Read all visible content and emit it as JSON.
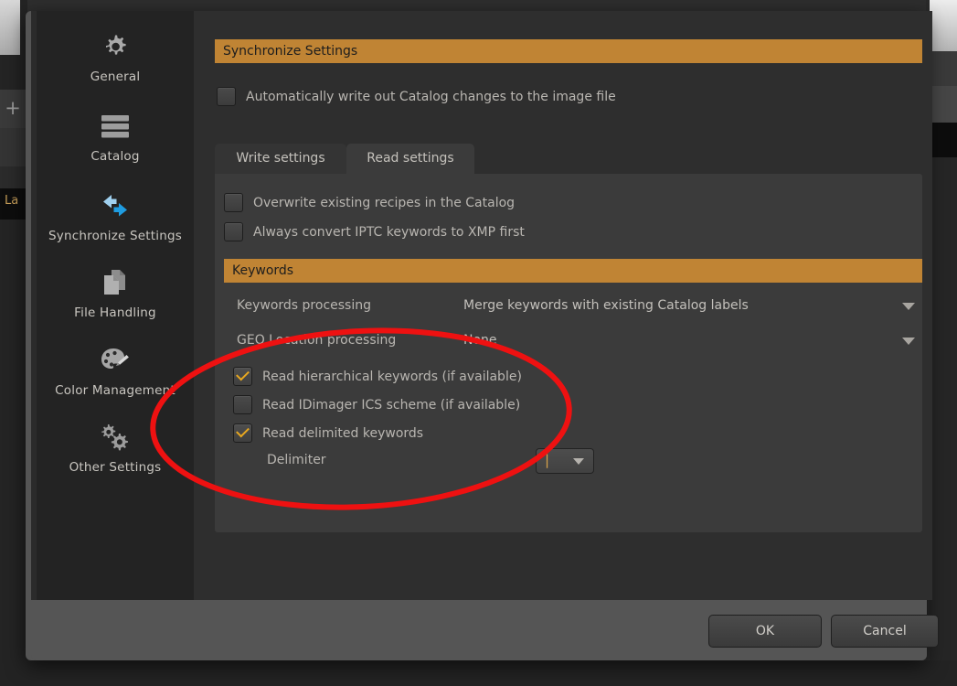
{
  "dialog": {
    "sidebar": {
      "items": [
        {
          "label": "General",
          "icon": "gear-icon"
        },
        {
          "label": "Catalog",
          "icon": "stacked-bars-icon"
        },
        {
          "label": "Synchronize Settings",
          "icon": "sync-arrows-icon"
        },
        {
          "label": "File Handling",
          "icon": "documents-icon"
        },
        {
          "label": "Color Management",
          "icon": "palette-icon"
        },
        {
          "label": "Other Settings",
          "icon": "double-gear-icon"
        }
      ]
    },
    "main": {
      "section_header": "Synchronize Settings",
      "auto_write_checkbox": {
        "label": "Automatically write out Catalog changes to the image file",
        "checked": false
      },
      "tabs": [
        {
          "label": "Write settings",
          "active": false
        },
        {
          "label": "Read settings",
          "active": true
        }
      ],
      "read_settings": {
        "checkboxes": [
          {
            "label": "Overwrite existing recipes in the Catalog",
            "checked": false
          },
          {
            "label": "Always convert IPTC keywords to XMP first",
            "checked": false
          }
        ],
        "keywords_header": "Keywords",
        "dropdowns": [
          {
            "label": "Keywords processing",
            "value": "Merge keywords with existing Catalog labels"
          },
          {
            "label": "GEO Location processing",
            "value": "None"
          }
        ],
        "keyword_checkboxes": [
          {
            "label": "Read hierarchical keywords (if available)",
            "checked": true
          },
          {
            "label": "Read IDimager ICS scheme (if available)",
            "checked": false
          },
          {
            "label": "Read delimited keywords",
            "checked": true
          }
        ],
        "delimiter": {
          "label": "Delimiter",
          "value": "|"
        }
      }
    },
    "footer": {
      "ok_label": "OK",
      "cancel_label": "Cancel"
    }
  },
  "background": {
    "plus_glyph": "+",
    "label_fragment": "La"
  },
  "colors": {
    "section_header_bg": "#c08434",
    "checkbox_check": "#e8a820",
    "annotation": "#ee1111",
    "panel_bg": "#3b3b3b",
    "dialog_bg": "#2e2e2e",
    "sidebar_bg": "#232323"
  }
}
